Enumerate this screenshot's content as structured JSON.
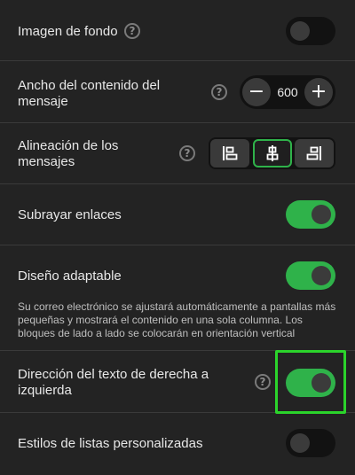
{
  "settings": {
    "background_image": {
      "label": "Imagen de fondo",
      "enabled": false
    },
    "content_width": {
      "label": "Ancho del contenido del mensaje",
      "value": "600",
      "decrement": "−",
      "increment": "+"
    },
    "alignment": {
      "label": "Alineación de los mensajes",
      "options": [
        "align-left-icon",
        "align-center-icon",
        "align-right-icon"
      ],
      "selected": "center"
    },
    "underline_links": {
      "label": "Subrayar enlaces",
      "enabled": true
    },
    "responsive_design": {
      "label": "Diseño adaptable",
      "enabled": true,
      "description": "Su correo electrónico se ajustará automáticamente a pantallas más pequeñas y mostrará el contenido en una sola columna. Los bloques de lado a lado se colocarán en orientación vertical"
    },
    "rtl_direction": {
      "label": "Dirección del texto de derecha a izquierda",
      "enabled": true
    },
    "custom_list_styles": {
      "label": "Estilos de listas personalizadas",
      "enabled": false
    }
  },
  "help_glyph": "?",
  "colors": {
    "accent": "#2fb24a",
    "highlight": "#2bd42b",
    "background": "#232323"
  }
}
